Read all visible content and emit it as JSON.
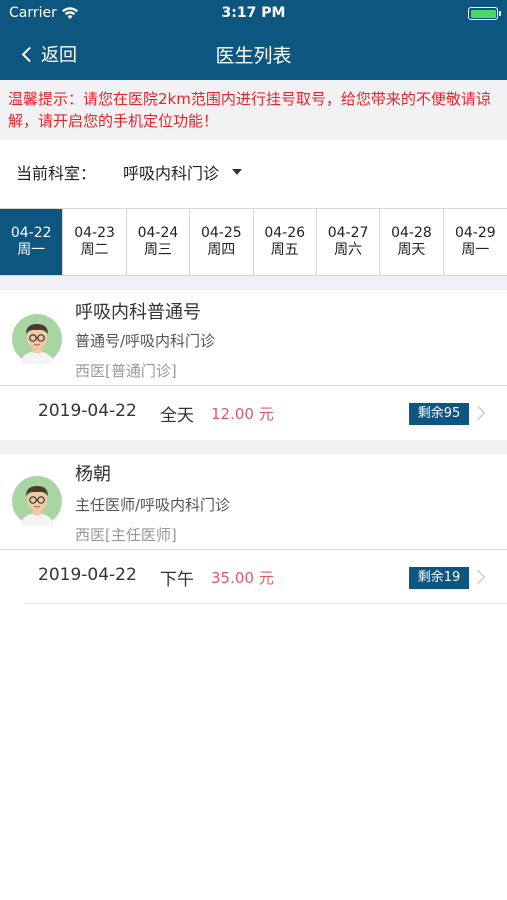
{
  "status_bar": {
    "carrier": "Carrier",
    "time": "3:17 PM"
  },
  "nav": {
    "back_label": "返回",
    "title": "医生列表"
  },
  "notice": {
    "text": "温馨提示：请您在医院2km范围内进行挂号取号，给您带来的不便敬请谅解，请开启您的手机定位功能！"
  },
  "department": {
    "label": "当前科室：",
    "value": "呼吸内科门诊"
  },
  "dates": [
    {
      "date": "04-22",
      "weekday": "周一",
      "active": true
    },
    {
      "date": "04-23",
      "weekday": "周二"
    },
    {
      "date": "04-24",
      "weekday": "周三"
    },
    {
      "date": "04-25",
      "weekday": "周四"
    },
    {
      "date": "04-26",
      "weekday": "周五"
    },
    {
      "date": "04-27",
      "weekday": "周六"
    },
    {
      "date": "04-28",
      "weekday": "周天"
    },
    {
      "date": "04-29",
      "weekday": "周一"
    }
  ],
  "doctors": [
    {
      "name": "呼吸内科普通号",
      "title": "普通号/呼吸内科门诊",
      "type": "西医[普通门诊]",
      "slot": {
        "date": "2019-04-22",
        "period": "全天",
        "fee": "12.00 元",
        "remaining": "剩余95"
      }
    },
    {
      "name": "杨朝",
      "title": "主任医师/呼吸内科门诊",
      "type": "西医[主任医师]",
      "slot": {
        "date": "2019-04-22",
        "period": "下午",
        "fee": "35.00 元",
        "remaining": "剩余19"
      }
    }
  ],
  "colors": {
    "brand": "#0d567f",
    "notice_text": "#e8242a",
    "fee_text": "#e0586a",
    "background_gap": "#f1f1f5"
  }
}
